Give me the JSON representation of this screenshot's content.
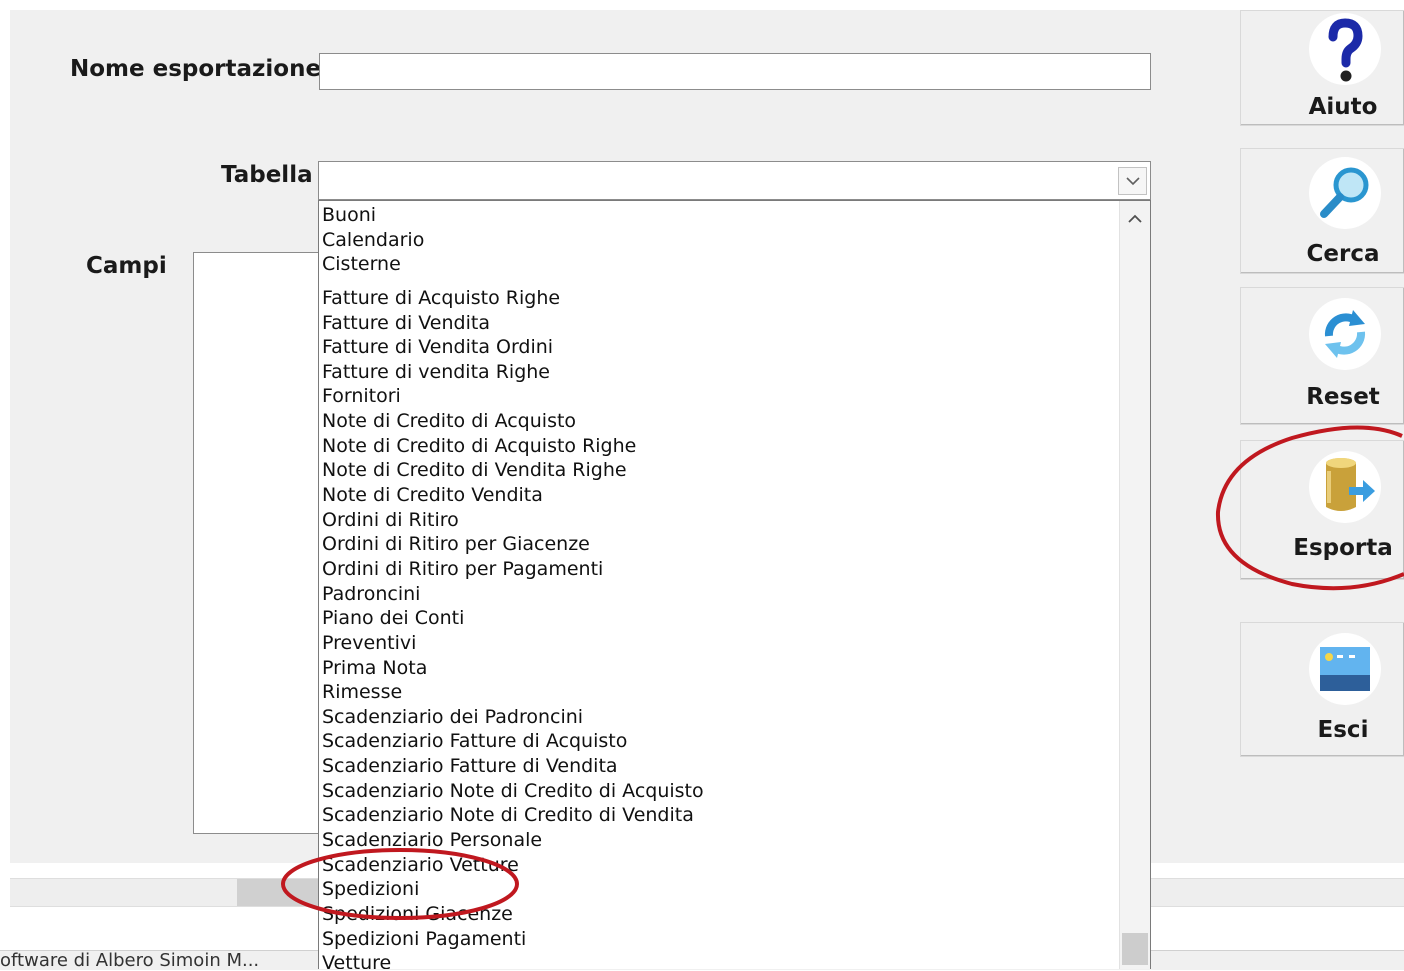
{
  "form": {
    "name_label": "Nome esportazione",
    "name_value": "",
    "table_label": "Tabella",
    "table_value": "",
    "fields_label": "Campi"
  },
  "dropdown": {
    "items": [
      "Buoni",
      "Calendario",
      "Cisterne",
      "Fatture di Acquisto Righe",
      "Fatture di Vendita",
      "Fatture di Vendita Ordini",
      "Fatture di vendita Righe",
      "Fornitori",
      "Note di Credito di Acquisto",
      "Note di Credito di Acquisto Righe",
      "Note di Credito di Vendita Righe",
      "Note di Credito Vendita",
      "Ordini di Ritiro",
      "Ordini di Ritiro per Giacenze",
      "Ordini di Ritiro per Pagamenti",
      "Padroncini",
      "Piano dei Conti",
      "Preventivi",
      "Prima Nota",
      "Rimesse",
      "Scadenziario dei Padroncini",
      "Scadenziario Fatture di Acquisto",
      "Scadenziario Fatture di Vendita",
      "Scadenziario Note di Credito di Acquisto",
      "Scadenziario Note di Credito di Vendita",
      "Scadenziario Personale",
      "Scadenziario Vetture",
      "Spedizioni",
      "Spedizioni Giacenze",
      "Spedizioni Pagamenti",
      "Vetture"
    ]
  },
  "sidebar": {
    "help_label": "Aiuto",
    "search_label": "Cerca",
    "reset_label": "Reset",
    "export_label": "Esporta",
    "exit_label": "Esci"
  },
  "status": {
    "text": "oftware di Albero Simoin M..."
  },
  "colors": {
    "annotation_red": "#c0181f",
    "window_bg": "#f0f0f0"
  },
  "icons": {
    "help": "question-mark-icon",
    "search": "magnifier-icon",
    "reset": "refresh-icon",
    "export": "export-database-icon",
    "exit": "exit-landscape-icon",
    "combo": "chevron-down-icon"
  }
}
